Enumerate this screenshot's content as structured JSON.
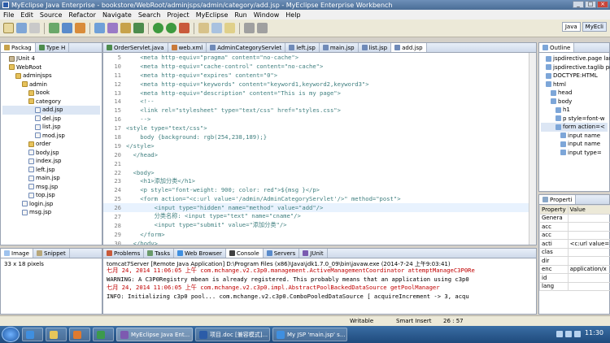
{
  "window": {
    "title": "MyEclipse Java Enterprise - bookstore/WebRoot/adminjsps/admin/category/add.jsp - MyEclipse Enterprise Workbench"
  },
  "menu": [
    "File",
    "Edit",
    "Source",
    "Refactor",
    "Navigate",
    "Search",
    "Project",
    "MyEclipse",
    "Run",
    "Window",
    "Help"
  ],
  "perspectives": {
    "java": "Java",
    "myecl": "MyEcli"
  },
  "package_explorer": {
    "tabs": [
      "Packag",
      "Type H"
    ],
    "tree": [
      {
        "label": "JUnit 4",
        "indent": 1,
        "icon": "lib"
      },
      {
        "label": "WebRoot",
        "indent": 1,
        "icon": "folder"
      },
      {
        "label": "adminjsps",
        "indent": 2,
        "icon": "folder"
      },
      {
        "label": "admin",
        "indent": 3,
        "icon": "folder"
      },
      {
        "label": "book",
        "indent": 4,
        "icon": "folder"
      },
      {
        "label": "category",
        "indent": 4,
        "icon": "folder"
      },
      {
        "label": "add.jsp",
        "indent": 5,
        "icon": "jsp",
        "selected": true
      },
      {
        "label": "del.jsp",
        "indent": 5,
        "icon": "jsp"
      },
      {
        "label": "list.jsp",
        "indent": 5,
        "icon": "jsp"
      },
      {
        "label": "mod.jsp",
        "indent": 5,
        "icon": "jsp"
      },
      {
        "label": "order",
        "indent": 4,
        "icon": "folder"
      },
      {
        "label": "body.jsp",
        "indent": 4,
        "icon": "jsp"
      },
      {
        "label": "index.jsp",
        "indent": 4,
        "icon": "jsp"
      },
      {
        "label": "left.jsp",
        "indent": 4,
        "icon": "jsp"
      },
      {
        "label": "main.jsp",
        "indent": 4,
        "icon": "jsp"
      },
      {
        "label": "msg.jsp",
        "indent": 4,
        "icon": "jsp"
      },
      {
        "label": "top.jsp",
        "indent": 4,
        "icon": "jsp"
      },
      {
        "label": "login.jsp",
        "indent": 3,
        "icon": "jsp"
      },
      {
        "label": "msg.jsp",
        "indent": 3,
        "icon": "jsp"
      }
    ]
  },
  "editor": {
    "tabs": [
      {
        "label": "OrderServlet.java",
        "active": false
      },
      {
        "label": "web.xml",
        "active": false
      },
      {
        "label": "AdminCategoryServlet",
        "active": false
      },
      {
        "label": "left.jsp",
        "active": false
      },
      {
        "label": "main.jsp",
        "active": false
      },
      {
        "label": "list.jsp",
        "active": false
      },
      {
        "label": "add.jsp",
        "active": true
      }
    ],
    "lines": [
      {
        "n": "5",
        "text": "    <meta http-equiv=\"pragma\" content=\"no-cache\">"
      },
      {
        "n": "10",
        "text": "    <meta http-equiv=\"cache-control\" content=\"no-cache\">"
      },
      {
        "n": "11",
        "text": "    <meta http-equiv=\"expires\" content=\"0\">"
      },
      {
        "n": "12",
        "text": "    <meta http-equiv=\"keywords\" content=\"keyword1,keyword2,keyword3\">"
      },
      {
        "n": "13",
        "text": "    <meta http-equiv=\"description\" content=\"This is my page\">"
      },
      {
        "n": "14",
        "text": "    <!--"
      },
      {
        "n": "15",
        "text": "    <link rel=\"stylesheet\" type=\"text/css\" href=\"styles.css\">"
      },
      {
        "n": "16",
        "text": "    -->"
      },
      {
        "n": "17",
        "text": "<style type=\"text/css\">"
      },
      {
        "n": "18",
        "text": "    body {background: rgb(254,238,189);}"
      },
      {
        "n": "19",
        "text": "</style>"
      },
      {
        "n": "20",
        "text": "  </head>"
      },
      {
        "n": "21",
        "text": ""
      },
      {
        "n": "22",
        "text": "  <body>"
      },
      {
        "n": "23",
        "text": "    <h1>添加分类</h1>"
      },
      {
        "n": "24",
        "text": "    <p style=\"font-weight: 900; color: red\">${msg }</p>"
      },
      {
        "n": "25",
        "text": "    <form action=\"<c:url value='/admin/AdminCategoryServlet'/>\" method=\"post\">"
      },
      {
        "n": "26",
        "text": "        <input type=\"hidden\" name=\"method\" value=\"add\"/>"
      },
      {
        "n": "27",
        "text": "        分类名称: <input type=\"text\" name=\"cname\"/>"
      },
      {
        "n": "28",
        "text": "        <input type=\"submit\" value=\"添加分类\"/>"
      },
      {
        "n": "29",
        "text": "    </form>"
      },
      {
        "n": "30",
        "text": "  </body>"
      },
      {
        "n": "31",
        "text": "</html>"
      }
    ]
  },
  "outline": {
    "tab": "Outline",
    "tab2": "Pale",
    "tree": [
      {
        "label": "jspdirective.page lan",
        "indent": 1
      },
      {
        "label": "jspdirective.taglib pr",
        "indent": 1
      },
      {
        "label": "DOCTYPE:HTML",
        "indent": 1
      },
      {
        "label": "html",
        "indent": 1
      },
      {
        "label": "head",
        "indent": 2
      },
      {
        "label": "body",
        "indent": 2
      },
      {
        "label": "h1",
        "indent": 3
      },
      {
        "label": "p style=font-w",
        "indent": 3
      },
      {
        "label": "form action=<",
        "indent": 3,
        "selected": true
      },
      {
        "label": "input name",
        "indent": 4
      },
      {
        "label": "input name",
        "indent": 4
      },
      {
        "label": "input type=",
        "indent": 4
      }
    ]
  },
  "properties": {
    "tab": "Properti",
    "headers": [
      "Property",
      "Value"
    ],
    "rows": [
      [
        "Genera",
        ""
      ],
      [
        "acc",
        ""
      ],
      [
        "acc",
        ""
      ],
      [
        "acti",
        "<c:url value="
      ],
      [
        "clas",
        ""
      ],
      [
        "dir",
        ""
      ],
      [
        "enc",
        "application/x"
      ],
      [
        "id",
        ""
      ],
      [
        "lang",
        ""
      ]
    ]
  },
  "image_view": {
    "tabs": [
      "Image",
      "Snippet"
    ],
    "size": "33 x 18 pixels"
  },
  "console": {
    "tabs": [
      "Problems",
      "Tasks",
      "Web Browser",
      "Console",
      "Servers",
      "JUnit"
    ],
    "active": "Console",
    "meta": "tomcat7Server [Remote Java Application] D:\\Program Files (x86)\\Java\\jdk1.7.0_09\\bin\\javaw.exe (2014-7-24 上午9:03:41)",
    "lines": [
      "七月 24, 2014 11:06:05 上午 com.mchange.v2.c3p0.management.ActiveManagementCoordinator attemptManageC3P0Re",
      "WARNING: A C3P0Registry mbean is already registered. This probably means that an application using c3p0",
      "七月 24, 2014 11:06:05 上午 com.mchange.v2.c3p0.impl.AbstractPoolBackedDataSource getPoolManager",
      "INFO: Initializing c3p0 pool... com.mchange.v2.c3p0.ComboPooledDataSource [ acquireIncrement -> 3, acqu"
    ]
  },
  "statusbar": {
    "mode": "Writable",
    "insert": "Smart Insert",
    "position": "26 : 57"
  },
  "taskbar": {
    "items": [
      "MyEclipse Java Ent...",
      "项目.doc [兼容模式]...",
      "My JSP 'main.jsp' s..."
    ],
    "clock": "11:30"
  }
}
